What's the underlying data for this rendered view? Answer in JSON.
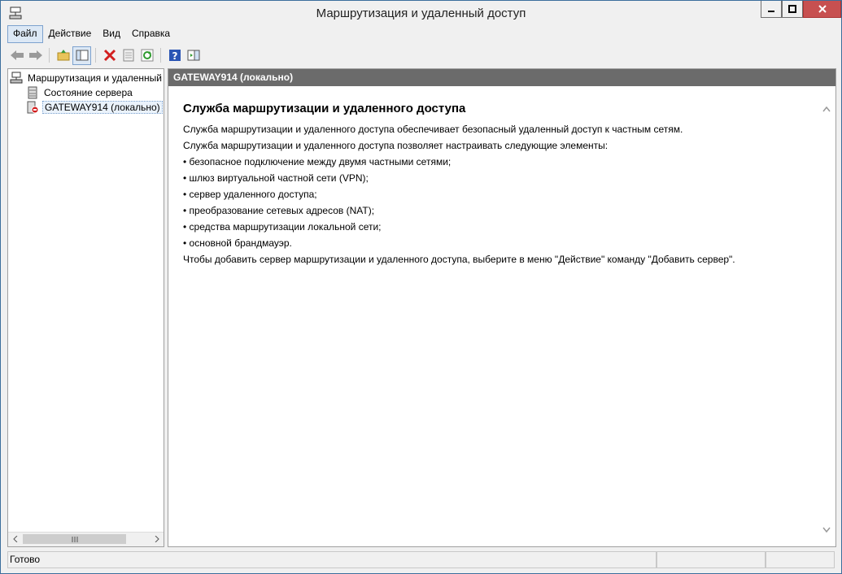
{
  "window": {
    "title": "Маршрутизация и удаленный доступ",
    "close_color": "#c75050"
  },
  "menubar": {
    "items": [
      {
        "label": "Файл"
      },
      {
        "label": "Действие"
      },
      {
        "label": "Вид"
      },
      {
        "label": "Справка"
      }
    ]
  },
  "toolbar": {
    "icons": [
      "back-icon",
      "forward-icon",
      "up-folder-icon",
      "show-hide-tree-icon",
      "delete-icon",
      "properties-icon",
      "refresh-icon",
      "help-icon",
      "action-pane-icon"
    ]
  },
  "tree": {
    "root_label": "Маршрутизация и удаленный",
    "items": [
      {
        "label": "Состояние сервера",
        "icon": "server-status-icon"
      },
      {
        "label": "GATEWAY914 (локально)",
        "icon": "server-stopped-icon",
        "selected": true
      }
    ]
  },
  "detail": {
    "header": "GATEWAY914 (локально)",
    "heading": "Служба маршрутизации и удаленного доступа",
    "lines": [
      "Служба маршрутизации и удаленного доступа обеспечивает безопасный удаленный доступ к частным сетям.",
      "Служба маршрутизации и удаленного доступа позволяет настраивать следующие элементы:",
      "• безопасное подключение между двумя частными сетями;",
      "• шлюз виртуальной частной сети (VPN);",
      "• сервер удаленного доступа;",
      "• преобразование сетевых адресов (NAT);",
      "• средства маршрутизации локальной сети;",
      "• основной брандмауэр.",
      "Чтобы добавить сервер маршрутизации и удаленного доступа, выберите в меню \"Действие\" команду \"Добавить сервер\"."
    ]
  },
  "statusbar": {
    "text": "Готово"
  }
}
